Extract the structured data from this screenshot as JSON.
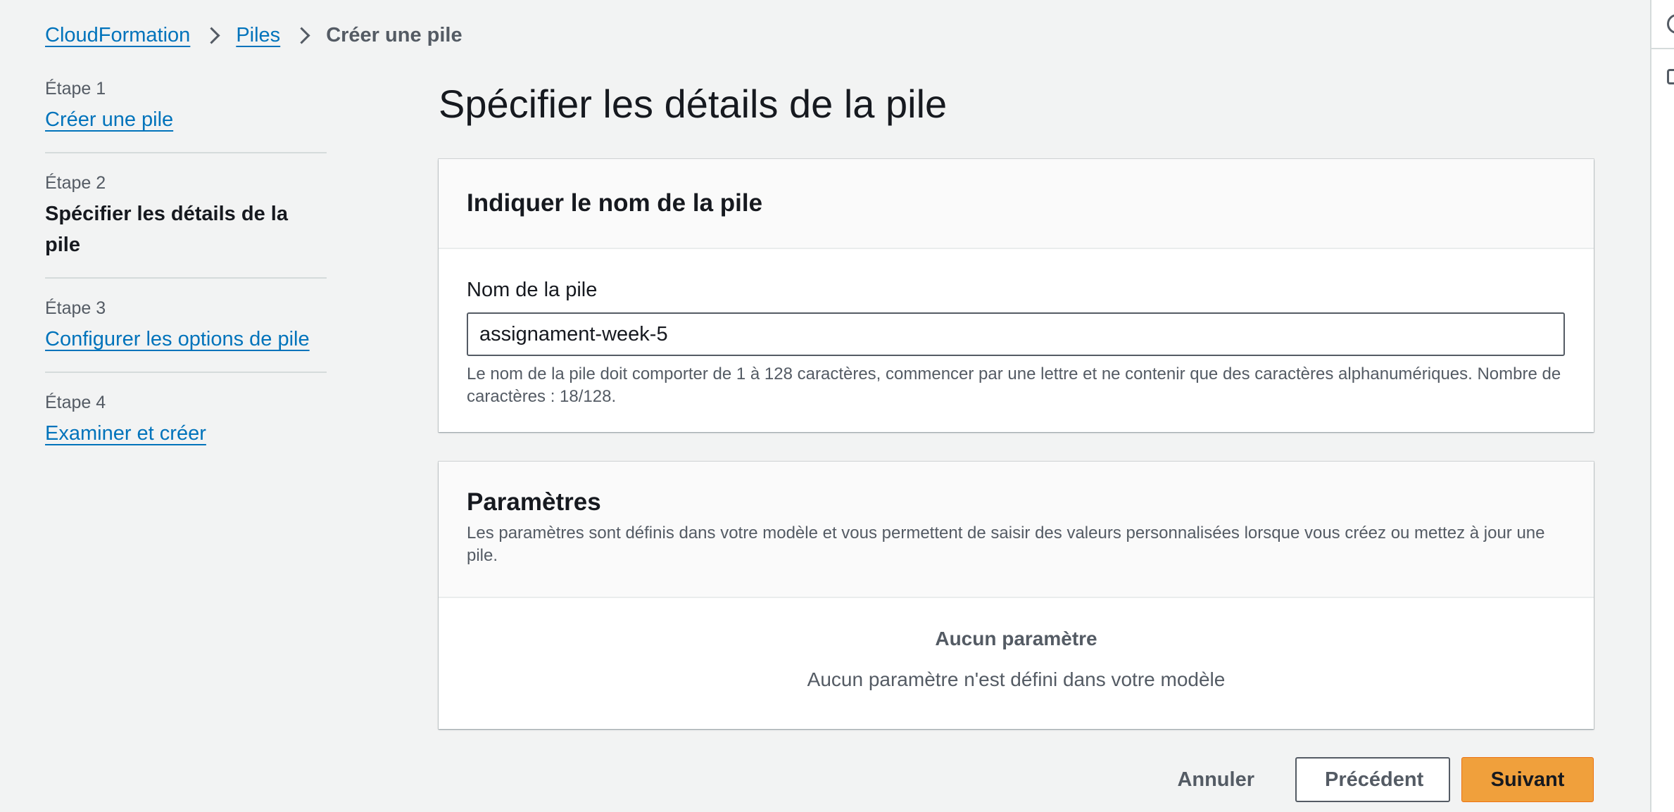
{
  "breadcrumb": {
    "items": [
      {
        "label": "CloudFormation"
      },
      {
        "label": "Piles"
      }
    ],
    "current": "Créer une pile"
  },
  "steps": [
    {
      "number": "Étape 1",
      "title": "Créer une pile",
      "state": "link"
    },
    {
      "number": "Étape 2",
      "title": "Spécifier les détails de la pile",
      "state": "current"
    },
    {
      "number": "Étape 3",
      "title": "Configurer les options de pile",
      "state": "link"
    },
    {
      "number": "Étape 4",
      "title": "Examiner et créer",
      "state": "link"
    }
  ],
  "page": {
    "title": "Spécifier les détails de la pile"
  },
  "stack_name_panel": {
    "title": "Indiquer le nom de la pile",
    "field_label": "Nom de la pile",
    "field_value": "assignament-week-5",
    "help_text": "Le nom de la pile doit comporter de 1 à 128 caractères, commencer par une lettre et ne contenir que des caractères alphanumériques. Nombre de caractères : 18/128."
  },
  "parameters_panel": {
    "title": "Paramètres",
    "description": "Les paramètres sont définis dans votre modèle et vous permettent de saisir des valeurs personnalisées lorsque vous créez ou mettez à jour une pile.",
    "empty_title": "Aucun paramètre",
    "empty_description": "Aucun paramètre n'est défini dans votre modèle"
  },
  "actions": {
    "cancel": "Annuler",
    "previous": "Précédent",
    "next": "Suivant"
  },
  "colors": {
    "link": "#0073bb",
    "primary_button": "#f0a03c",
    "background": "#f2f3f3"
  },
  "right_rail": {
    "icons": [
      "info-circle-icon",
      "notes-icon"
    ]
  }
}
